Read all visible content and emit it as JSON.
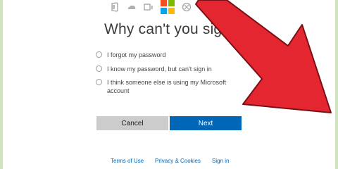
{
  "header": {
    "icons": [
      "office-icon",
      "onedrive-icon",
      "outlook-icon",
      "microsoft-logo",
      "xbox-icon"
    ],
    "ms_colors": [
      "#f25022",
      "#7fba00",
      "#00a4ef",
      "#ffb900"
    ]
  },
  "main": {
    "title": "Why can't you sig",
    "options": [
      "I forgot my password",
      "I know my password, but can't sign in",
      "I think someone else is using my Microsoft account"
    ]
  },
  "buttons": {
    "cancel": "Cancel",
    "next": "Next"
  },
  "footer": {
    "terms": "Terms of Use",
    "privacy": "Privacy & Cookies",
    "signin": "Sign in"
  },
  "colors": {
    "accent": "#0067b8",
    "arrow": "#e3262f"
  }
}
